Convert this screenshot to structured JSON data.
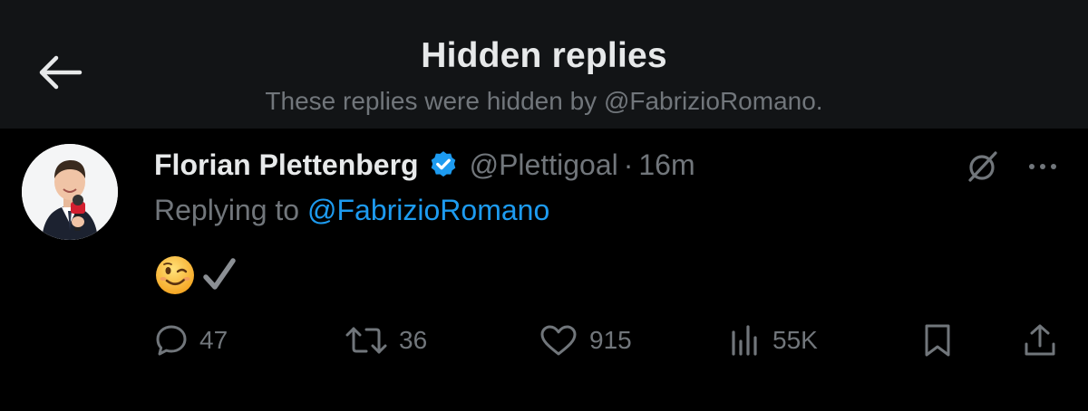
{
  "header": {
    "title": "Hidden replies",
    "subtitle": "These replies were hidden by @FabrizioRomano.",
    "back_icon": "arrow-left-icon"
  },
  "tweet": {
    "author_name": "Florian Plettenberg",
    "handle": "@Plettigoal",
    "separator": "·",
    "time": "16m",
    "verified": true,
    "reply_prefix": "Replying to ",
    "reply_to": "@FabrizioRomano",
    "content_icons": [
      "winking-face-icon",
      "check-mark-icon"
    ],
    "actions": {
      "replies": "47",
      "reposts": "36",
      "likes": "915",
      "views": "55K"
    }
  },
  "colors": {
    "background": "#000000",
    "header_background": "#121416",
    "primary_text": "#e7e9ea",
    "secondary_text": "#71767b",
    "link": "#1d9bf0",
    "verified": "#1d9bf0"
  }
}
